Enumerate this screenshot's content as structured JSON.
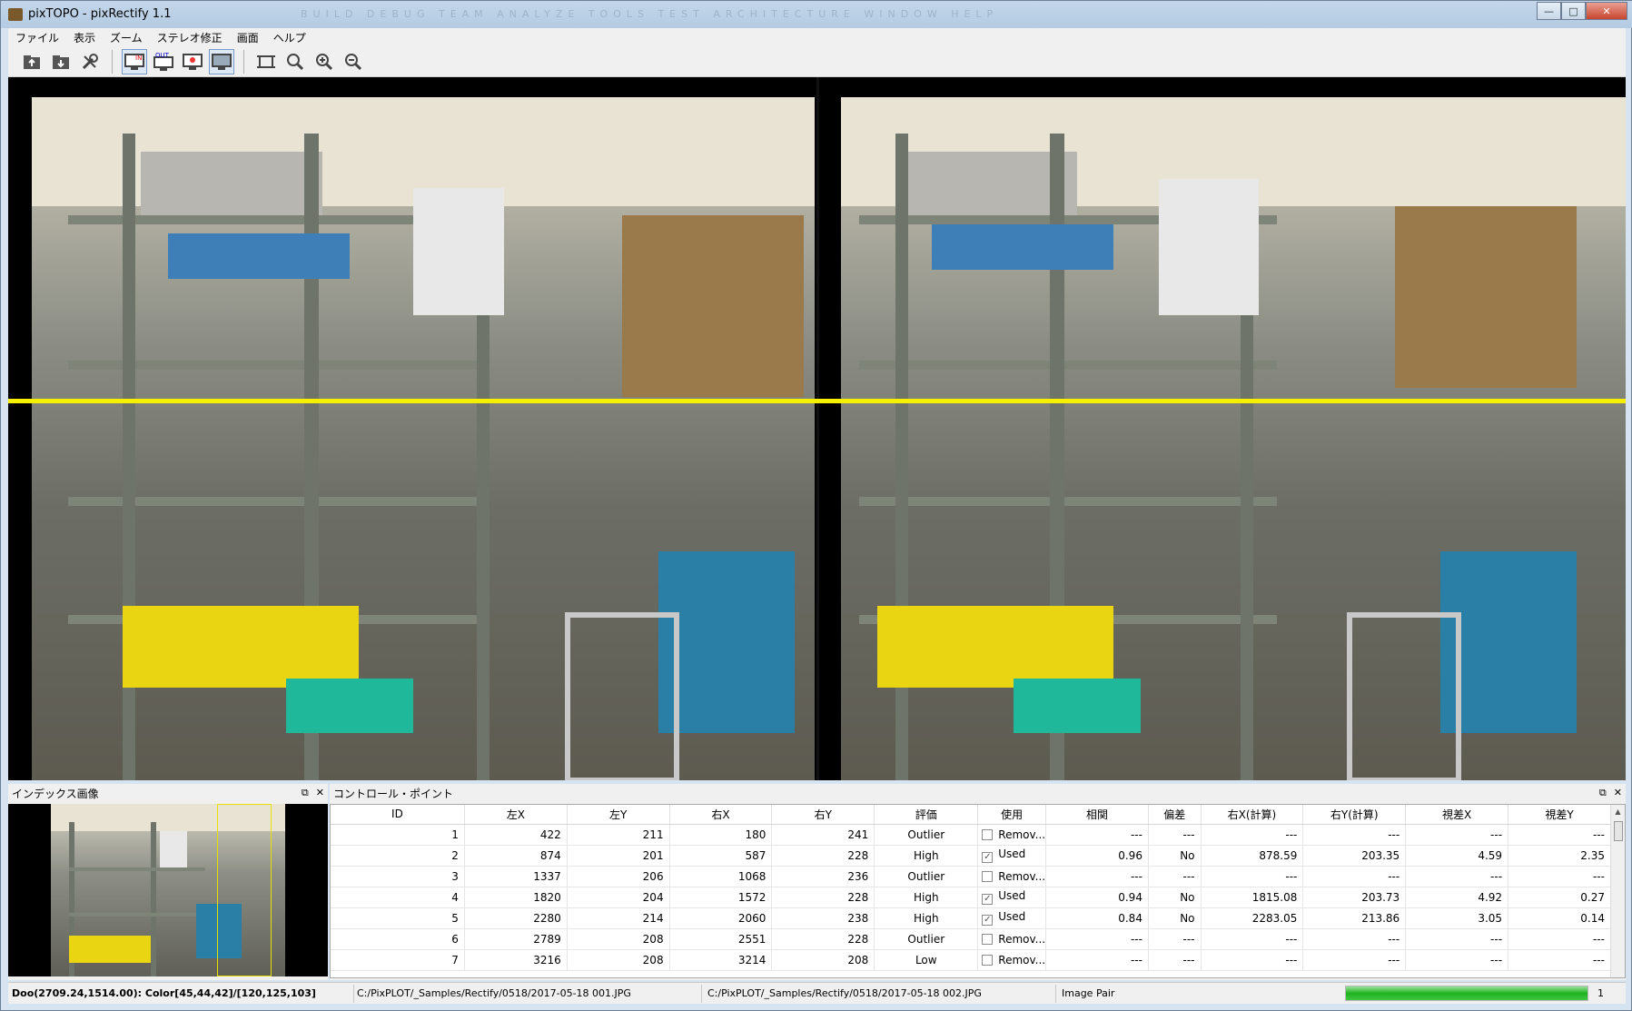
{
  "window": {
    "title": "pixTOPO - pixRectify 1.1",
    "background_ghost": "BUILD  DEBUG  TEAM  ANALYZE  TOOLS  TEST  ARCHITECTURE  WINDOW  HELP",
    "minimize": "—",
    "maximize": "□",
    "close": "✕"
  },
  "menu": [
    "ファイル",
    "表示",
    "ズーム",
    "ステレオ修正",
    "画面",
    "ヘルプ"
  ],
  "toolbar": {
    "in_label": "IN",
    "out_label": "OUT"
  },
  "index_panel": {
    "title": "インデックス画像"
  },
  "cp_panel": {
    "title": "コントロール・ポイント",
    "columns": [
      "ID",
      "左X",
      "左Y",
      "右X",
      "右Y",
      "評価",
      "使用",
      "相関",
      "偏差",
      "右X(計算)",
      "右Y(計算)",
      "視差X",
      "視差Y"
    ],
    "rows": [
      {
        "id": "1",
        "lx": "422",
        "ly": "211",
        "rx": "180",
        "ry": "241",
        "rating": "Outlier",
        "used": false,
        "use_label": "Remov...",
        "corr": "---",
        "dev": "---",
        "rxc": "---",
        "ryc": "---",
        "px": "---",
        "py": "---"
      },
      {
        "id": "2",
        "lx": "874",
        "ly": "201",
        "rx": "587",
        "ry": "228",
        "rating": "High",
        "used": true,
        "use_label": "Used",
        "corr": "0.96",
        "dev": "No",
        "rxc": "878.59",
        "ryc": "203.35",
        "px": "4.59",
        "py": "2.35"
      },
      {
        "id": "3",
        "lx": "1337",
        "ly": "206",
        "rx": "1068",
        "ry": "236",
        "rating": "Outlier",
        "used": false,
        "use_label": "Remov...",
        "corr": "---",
        "dev": "---",
        "rxc": "---",
        "ryc": "---",
        "px": "---",
        "py": "---"
      },
      {
        "id": "4",
        "lx": "1820",
        "ly": "204",
        "rx": "1572",
        "ry": "228",
        "rating": "High",
        "used": true,
        "use_label": "Used",
        "corr": "0.94",
        "dev": "No",
        "rxc": "1815.08",
        "ryc": "203.73",
        "px": "4.92",
        "py": "0.27"
      },
      {
        "id": "5",
        "lx": "2280",
        "ly": "214",
        "rx": "2060",
        "ry": "238",
        "rating": "High",
        "used": true,
        "use_label": "Used",
        "corr": "0.84",
        "dev": "No",
        "rxc": "2283.05",
        "ryc": "213.86",
        "px": "3.05",
        "py": "0.14"
      },
      {
        "id": "6",
        "lx": "2789",
        "ly": "208",
        "rx": "2551",
        "ry": "228",
        "rating": "Outlier",
        "used": false,
        "use_label": "Remov...",
        "corr": "---",
        "dev": "---",
        "rxc": "---",
        "ryc": "---",
        "px": "---",
        "py": "---"
      },
      {
        "id": "7",
        "lx": "3216",
        "ly": "208",
        "rx": "3214",
        "ry": "208",
        "rating": "Low",
        "used": false,
        "use_label": "Remov...",
        "corr": "---",
        "dev": "---",
        "rxc": "---",
        "ryc": "---",
        "px": "---",
        "py": "---"
      }
    ]
  },
  "status": {
    "coords": "Doo(2709.24,1514.00): Color[45,44,42]/[120,125,103]",
    "left_path": "C:/PixPLOT/_Samples/Rectify/0518/2017-05-18 001.JPG",
    "right_path": "C:/PixPLOT/_Samples/Rectify/0518/2017-05-18 002.JPG",
    "mode": "Image Pair",
    "progress_fraction": 1.0,
    "page": "1"
  },
  "colors": {
    "epipolar_line": "#f6f000",
    "progress": "#1eb31e"
  }
}
